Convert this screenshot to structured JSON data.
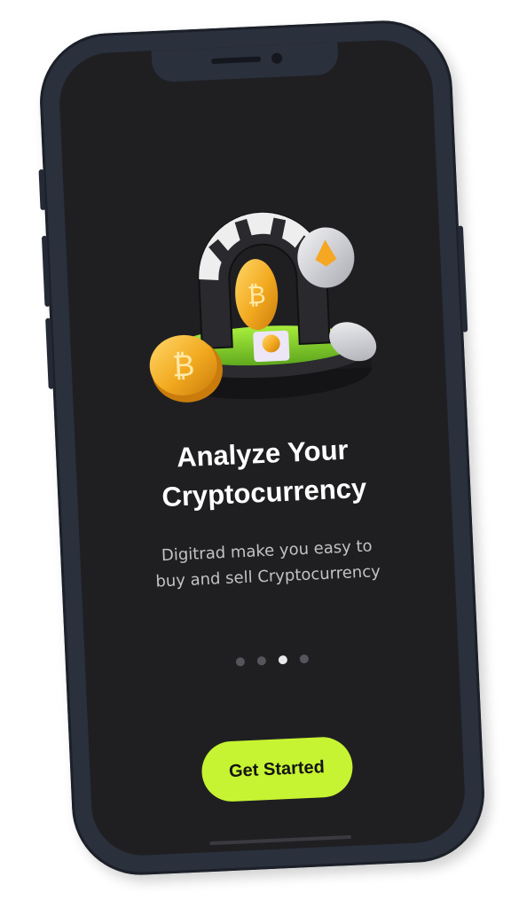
{
  "onboarding": {
    "title_line1": "Analyze Your",
    "title_line2": "Cryptocurrency",
    "subtitle_line1": "Digitrad make you easy to",
    "subtitle_line2": "buy and sell Cryptocurrency",
    "cta_label": "Get Started",
    "page_index": 3,
    "page_count": 4
  },
  "colors": {
    "background": "#1f1f22",
    "phone_frame": "#2a303c",
    "accent": "#c6f432",
    "dot_active": "#e8e8ea",
    "dot_inactive": "#55555c"
  },
  "icons": {
    "illustration": "crypto-coins-3d-illustration"
  }
}
